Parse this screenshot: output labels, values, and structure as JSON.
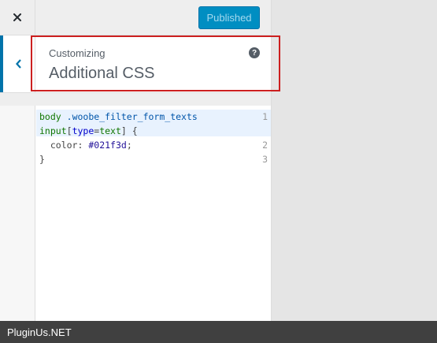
{
  "header": {
    "close_icon": "close-icon",
    "publish_label": "Published"
  },
  "section": {
    "back_icon": "chevron-left-icon",
    "customizing_label": "Customizing",
    "title": "Additional CSS",
    "help_symbol": "?"
  },
  "editor": {
    "line_numbers": [
      "1",
      "2",
      "3"
    ],
    "line1a_sel": "body",
    "line1a_cls": ".woobe_filter_form_texts",
    "line1b_tag": "input",
    "line1b_open": "[",
    "line1b_attr": "type",
    "line1b_eq": "=",
    "line1b_val": "text",
    "line1b_close": "]",
    "line1b_brace": "{",
    "line2_prop": "color",
    "line2_colon": ":",
    "line2_value": "#021f3d",
    "line2_semi": ";",
    "line3": "}"
  },
  "colors": {
    "accent": "#0073aa",
    "publish_bg": "#008ec2",
    "highlight": "#cc1f1f",
    "footer_bg": "#404040"
  },
  "footer": {
    "brand": "PluginUs.NET"
  }
}
